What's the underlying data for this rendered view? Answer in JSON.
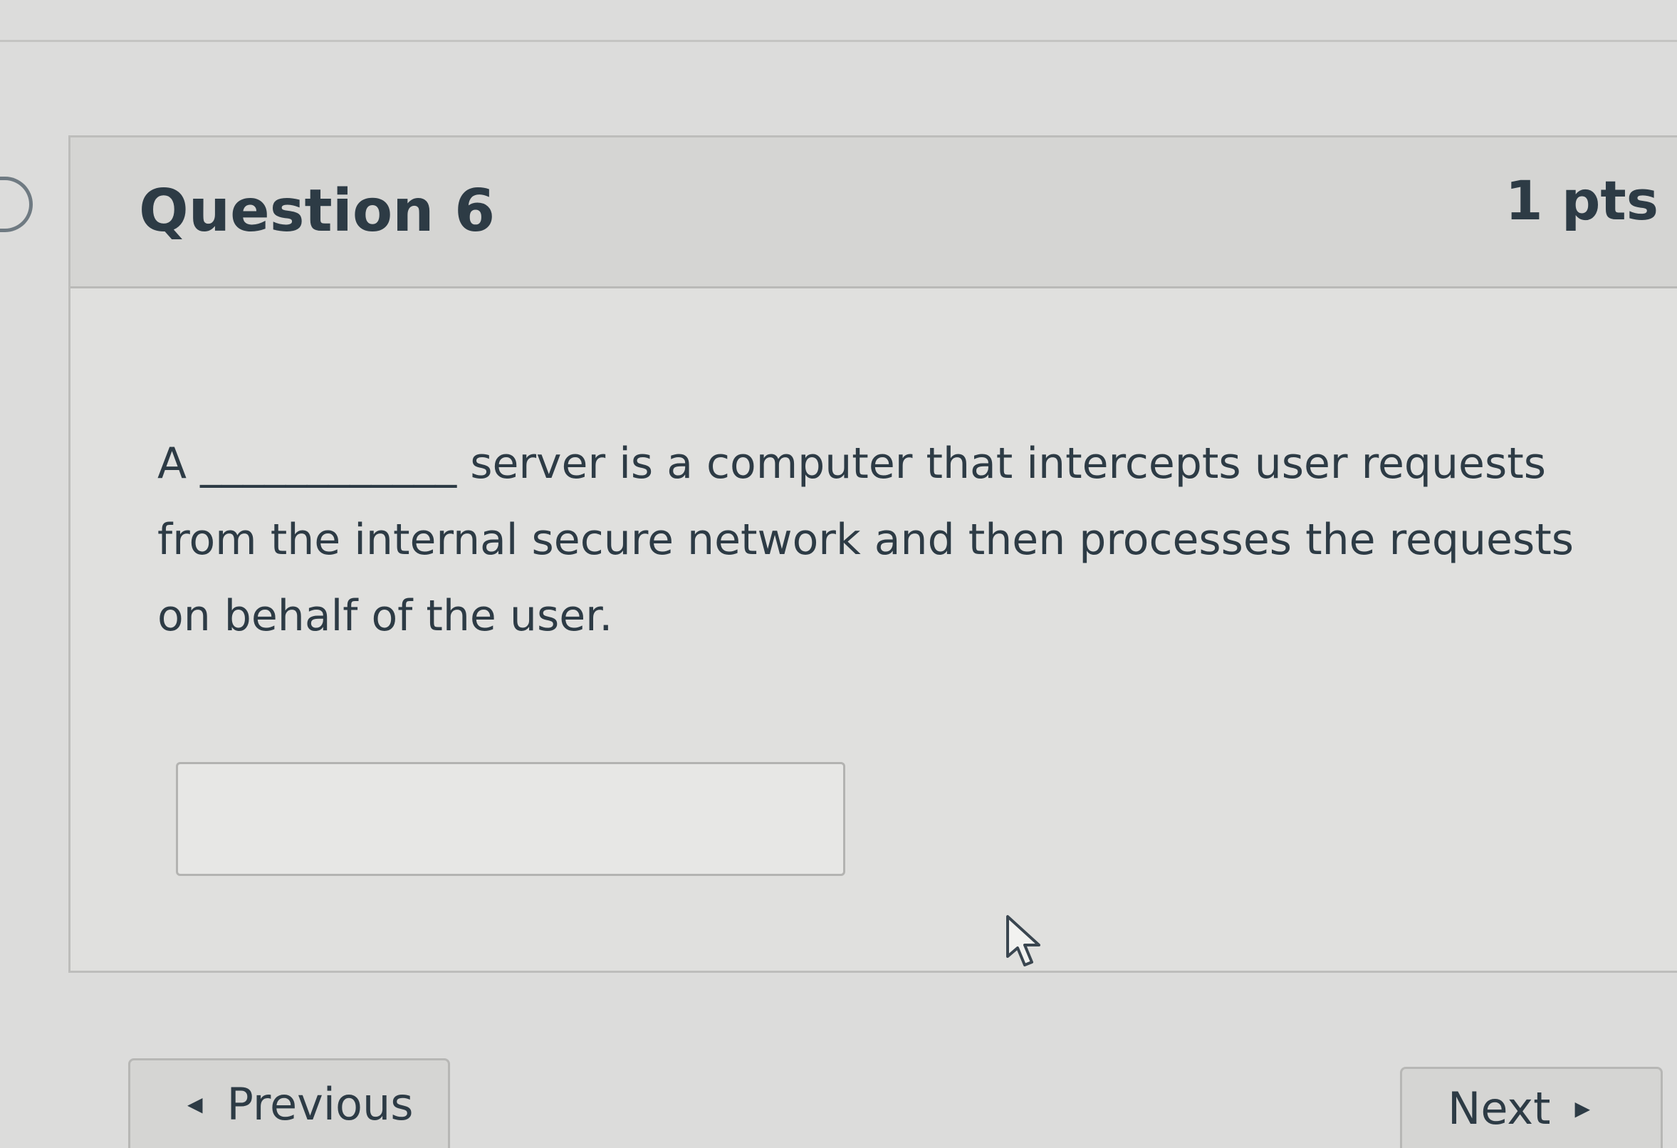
{
  "question": {
    "title": "Question 6",
    "points": "1 pts",
    "text": "A ____________ server is a computer that intercepts user requests from the internal secure network and then processes the requests on behalf of the user."
  },
  "answer_field": {
    "value": "",
    "placeholder": ""
  },
  "navigation": {
    "previous_label": "Previous",
    "next_label": "Next",
    "previous_icon": "caret-left-icon",
    "next_icon": "caret-right-icon"
  },
  "icons": {
    "flag": "flag-question-icon",
    "cursor": "mouse-pointer-icon"
  },
  "colors": {
    "text": "#2d3b45",
    "background": "#dcdcdb",
    "header_background": "#d5d5d3",
    "border": "#bdbdbb"
  }
}
